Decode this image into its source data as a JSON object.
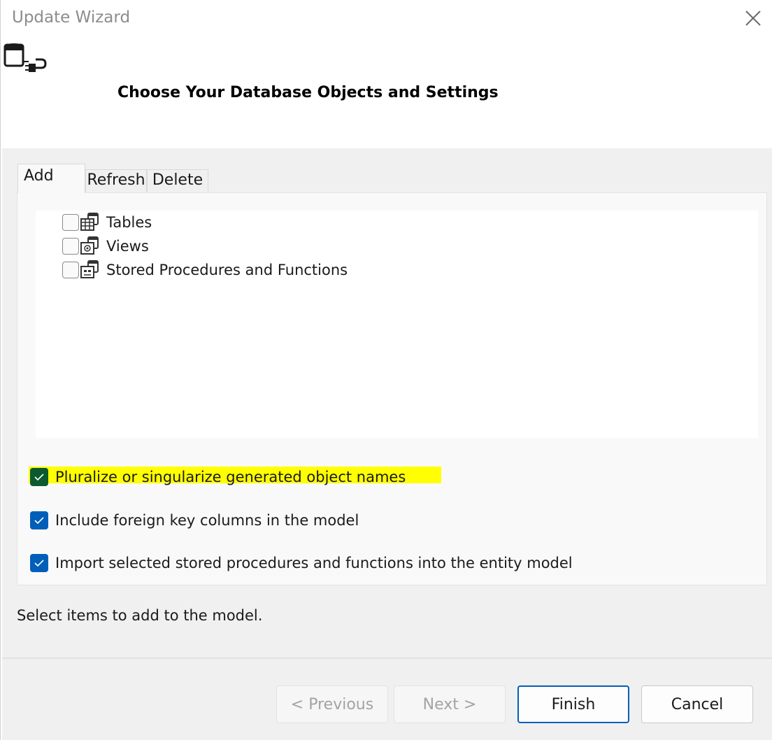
{
  "window": {
    "title": "Update Wizard"
  },
  "header": {
    "title": "Choose Your Database Objects and Settings",
    "icon": "database-connection-icon"
  },
  "tabs": [
    {
      "label": "Add",
      "active": true
    },
    {
      "label": "Refresh",
      "active": false
    },
    {
      "label": "Delete",
      "active": false
    }
  ],
  "tree": {
    "items": [
      {
        "label": "Tables",
        "checked": false,
        "icon": "database-table-icon"
      },
      {
        "label": "Views",
        "checked": false,
        "icon": "database-view-icon"
      },
      {
        "label": "Stored Procedures and Functions",
        "checked": false,
        "icon": "stored-procedure-icon"
      }
    ]
  },
  "options": [
    {
      "label": "Pluralize or singularize generated object names",
      "checked": true,
      "highlighted": true
    },
    {
      "label": "Include foreign key columns in the model",
      "checked": true
    },
    {
      "label": "Import selected stored procedures and functions into the entity model",
      "checked": true
    }
  ],
  "status": {
    "text": "Select items to add to the model."
  },
  "buttons": {
    "previous": {
      "label": "< Previous",
      "enabled": false
    },
    "next": {
      "label": "Next >",
      "enabled": false
    },
    "finish": {
      "label": "Finish",
      "enabled": true,
      "default": true
    },
    "cancel": {
      "label": "Cancel",
      "enabled": true
    }
  },
  "colors": {
    "accent": "#005fb8",
    "highlight": "#ffff00",
    "title_text": "#8c8c8c"
  }
}
